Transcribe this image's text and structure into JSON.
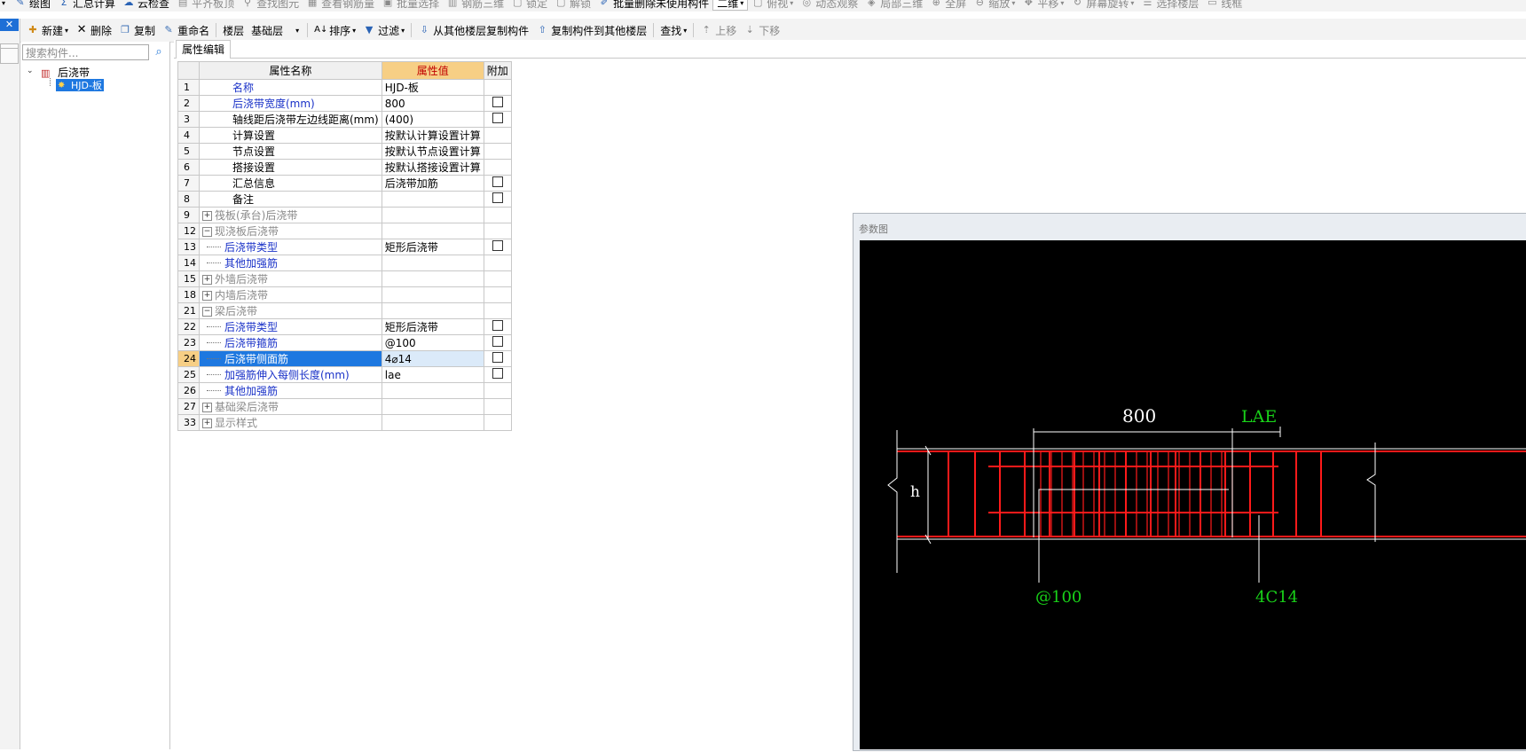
{
  "toolbar1": {
    "items": [
      {
        "label": "绘图",
        "icon": "draw-icon",
        "disabled": false
      },
      {
        "label": "汇总计算",
        "icon": "sigma-icon",
        "disabled": false
      },
      {
        "label": "云检查",
        "icon": "cloud-check-icon",
        "disabled": false
      },
      {
        "label": "平齐板顶",
        "icon": "align-top-icon",
        "disabled": true
      },
      {
        "label": "查找图元",
        "icon": "find-element-icon",
        "disabled": true
      },
      {
        "label": "查看钢筋量",
        "icon": "rebar-qty-icon",
        "disabled": true
      },
      {
        "label": "批量选择",
        "icon": "batch-select-icon",
        "disabled": true
      },
      {
        "label": "钢筋三维",
        "icon": "rebar-3d-icon",
        "disabled": true
      },
      {
        "label": "锁定",
        "icon": "lock-icon",
        "disabled": true
      },
      {
        "label": "解锁",
        "icon": "unlock-icon",
        "disabled": true
      },
      {
        "label": "批量删除未使用构件",
        "icon": "batch-delete-icon",
        "disabled": false
      }
    ],
    "view_mode": "二维",
    "view_items": [
      {
        "label": "俯视",
        "icon": "top-view-icon",
        "dropdown": true
      },
      {
        "label": "动态观察",
        "icon": "orbit-icon",
        "dropdown": false
      },
      {
        "label": "局部三维",
        "icon": "local-3d-icon",
        "dropdown": false
      },
      {
        "label": "全屏",
        "icon": "fullscreen-icon",
        "dropdown": false
      },
      {
        "label": "缩放",
        "icon": "zoom-icon",
        "dropdown": true
      },
      {
        "label": "平移",
        "icon": "pan-icon",
        "dropdown": true
      },
      {
        "label": "屏幕旋转",
        "icon": "rotate-icon",
        "dropdown": true
      },
      {
        "label": "选择楼层",
        "icon": "select-floor-icon",
        "dropdown": false
      },
      {
        "label": "线框",
        "icon": "wireframe-icon",
        "dropdown": false
      }
    ]
  },
  "toolbar2": {
    "new": "新建",
    "delete": "删除",
    "copy": "复制",
    "rename": "重命名",
    "floor_label": "楼层",
    "floor_value": "基础层",
    "sort": "排序",
    "filter": "过滤",
    "copy_from_other": "从其他楼层复制构件",
    "copy_to_other": "复制构件到其他楼层",
    "find": "查找",
    "move_up": "上移",
    "move_down": "下移"
  },
  "tree": {
    "search_placeholder": "搜索构件...",
    "root_label": "后浇带",
    "child_label": "HJD-板"
  },
  "tab": {
    "label": "属性编辑"
  },
  "grid": {
    "headers": {
      "name": "属性名称",
      "value": "属性值",
      "extra": "附加"
    },
    "rows": [
      {
        "num": "1",
        "name": "名称",
        "value": "HJD-板",
        "check": false,
        "style": "blue",
        "level": 0,
        "expander": "",
        "selected": false
      },
      {
        "num": "2",
        "name": "后浇带宽度(mm)",
        "value": "800",
        "check": true,
        "style": "blue",
        "level": 0,
        "expander": "",
        "selected": false
      },
      {
        "num": "3",
        "name": "轴线距后浇带左边线距离(mm)",
        "value": "(400)",
        "check": true,
        "style": "black",
        "level": 0,
        "expander": "",
        "selected": false
      },
      {
        "num": "4",
        "name": "计算设置",
        "value": "按默认计算设置计算",
        "check": false,
        "style": "black",
        "level": 0,
        "expander": "",
        "selected": false
      },
      {
        "num": "5",
        "name": "节点设置",
        "value": "按默认节点设置计算",
        "check": false,
        "style": "black",
        "level": 0,
        "expander": "",
        "selected": false
      },
      {
        "num": "6",
        "name": "搭接设置",
        "value": "按默认搭接设置计算",
        "check": false,
        "style": "black",
        "level": 0,
        "expander": "",
        "selected": false
      },
      {
        "num": "7",
        "name": "汇总信息",
        "value": "后浇带加筋",
        "check": true,
        "style": "black",
        "level": 0,
        "expander": "",
        "selected": false
      },
      {
        "num": "8",
        "name": "备注",
        "value": "",
        "check": true,
        "style": "black",
        "level": 0,
        "expander": "",
        "selected": false
      },
      {
        "num": "9",
        "name": "筏板(承台)后浇带",
        "value": "",
        "check": false,
        "style": "gray",
        "level": 0,
        "expander": "+",
        "selected": false
      },
      {
        "num": "12",
        "name": "现浇板后浇带",
        "value": "",
        "check": false,
        "style": "gray",
        "level": 0,
        "expander": "−",
        "selected": false
      },
      {
        "num": "13",
        "name": "后浇带类型",
        "value": "矩形后浇带",
        "check": true,
        "style": "blue",
        "level": 1,
        "expander": "",
        "selected": false
      },
      {
        "num": "14",
        "name": "其他加强筋",
        "value": "",
        "check": false,
        "style": "blue",
        "level": 1,
        "expander": "",
        "selected": false
      },
      {
        "num": "15",
        "name": "外墙后浇带",
        "value": "",
        "check": false,
        "style": "gray",
        "level": 0,
        "expander": "+",
        "selected": false
      },
      {
        "num": "18",
        "name": "内墙后浇带",
        "value": "",
        "check": false,
        "style": "gray",
        "level": 0,
        "expander": "+",
        "selected": false
      },
      {
        "num": "21",
        "name": "梁后浇带",
        "value": "",
        "check": false,
        "style": "gray",
        "level": 0,
        "expander": "−",
        "selected": false
      },
      {
        "num": "22",
        "name": "后浇带类型",
        "value": "矩形后浇带",
        "check": true,
        "style": "blue",
        "level": 1,
        "expander": "",
        "selected": false
      },
      {
        "num": "23",
        "name": "后浇带箍筋",
        "value": "@100",
        "check": true,
        "style": "blue",
        "level": 1,
        "expander": "",
        "selected": false
      },
      {
        "num": "24",
        "name": "后浇带侧面筋",
        "value": "4⌀14",
        "check": true,
        "style": "blue",
        "level": 1,
        "expander": "",
        "selected": true
      },
      {
        "num": "25",
        "name": "加强筋伸入每侧长度(mm)",
        "value": "lae",
        "check": true,
        "style": "blue",
        "level": 1,
        "expander": "",
        "selected": false
      },
      {
        "num": "26",
        "name": "其他加强筋",
        "value": "",
        "check": false,
        "style": "blue",
        "level": 1,
        "expander": "",
        "selected": false
      },
      {
        "num": "27",
        "name": "基础梁后浇带",
        "value": "",
        "check": false,
        "style": "gray",
        "level": 0,
        "expander": "+",
        "selected": false
      },
      {
        "num": "33",
        "name": "显示样式",
        "value": "",
        "check": false,
        "style": "gray",
        "level": 0,
        "expander": "+",
        "selected": false
      }
    ]
  },
  "param": {
    "title": "参数图",
    "width_label": "800",
    "lae_label": "LAE",
    "h_label": "h",
    "stirrup_label": "@100",
    "side_bar_label": "4C14",
    "colors": {
      "rebar": "#ff1a1a",
      "dim": "#ffffff",
      "accent": "#19d219"
    }
  }
}
